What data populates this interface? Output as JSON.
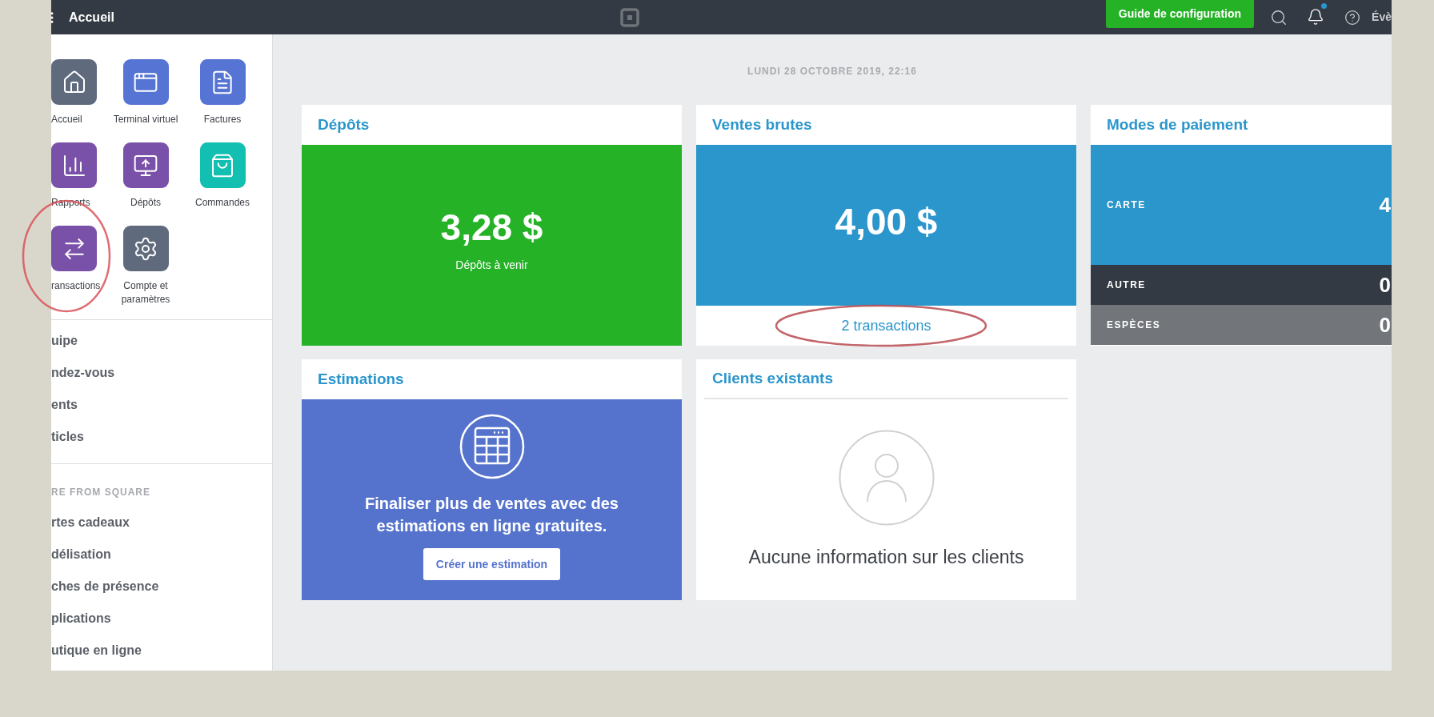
{
  "topbar": {
    "title": "Accueil",
    "setup_button": "Guide de configuration",
    "notification_unread": true,
    "account_label": "Évè"
  },
  "sidebar": {
    "apps": [
      {
        "label": "Accueil",
        "kind": "home",
        "color": "#5f6b7d"
      },
      {
        "label": "Terminal virtuel",
        "kind": "terminal",
        "color": "#5574d3"
      },
      {
        "label": "Factures",
        "kind": "invoice",
        "color": "#5574d3"
      },
      {
        "label": "Rapports",
        "kind": "chart",
        "color": "#7a51a8"
      },
      {
        "label": "Dépôts",
        "kind": "deposit",
        "color": "#7a51a8"
      },
      {
        "label": "Commandes",
        "kind": "bag",
        "color": "#13bfb0"
      },
      {
        "label": "ransactions",
        "kind": "transfer",
        "color": "#7a51a8"
      },
      {
        "label": "Compte et paramètres",
        "kind": "gear",
        "color": "#5f6b7d"
      }
    ],
    "nav_items": [
      "uipe",
      "ndez-vous",
      "ents",
      "ticles"
    ],
    "section_title": "RE FROM SQUARE",
    "more_items": [
      "rtes cadeaux",
      "délisation",
      "ches de présence",
      "plications",
      "utique en ligne"
    ]
  },
  "date": "LUNDI 28 OCTOBRE 2019, 22:16",
  "deposits": {
    "title": "Dépôts",
    "amount": "3,28 $",
    "caption": "Dépôts à venir"
  },
  "gross_sales": {
    "title": "Ventes brutes",
    "amount": "4,00 $",
    "link": "2 transactions"
  },
  "payment_methods": {
    "title": "Modes de paiement",
    "rows": [
      {
        "label": "CARTE",
        "amount": "4",
        "color": "#2b96cc"
      },
      {
        "label": "AUTRE",
        "amount": "0",
        "color": "#343a43"
      },
      {
        "label": "ESPÈCES",
        "amount": "0",
        "color": "#72767a"
      }
    ]
  },
  "estimates": {
    "title": "Estimations",
    "text": "Finaliser plus de ventes avec des estimations en ligne gratuites.",
    "button": "Créer une estimation"
  },
  "customers": {
    "title": "Clients existants",
    "empty_text": "Aucune information sur les clients"
  }
}
